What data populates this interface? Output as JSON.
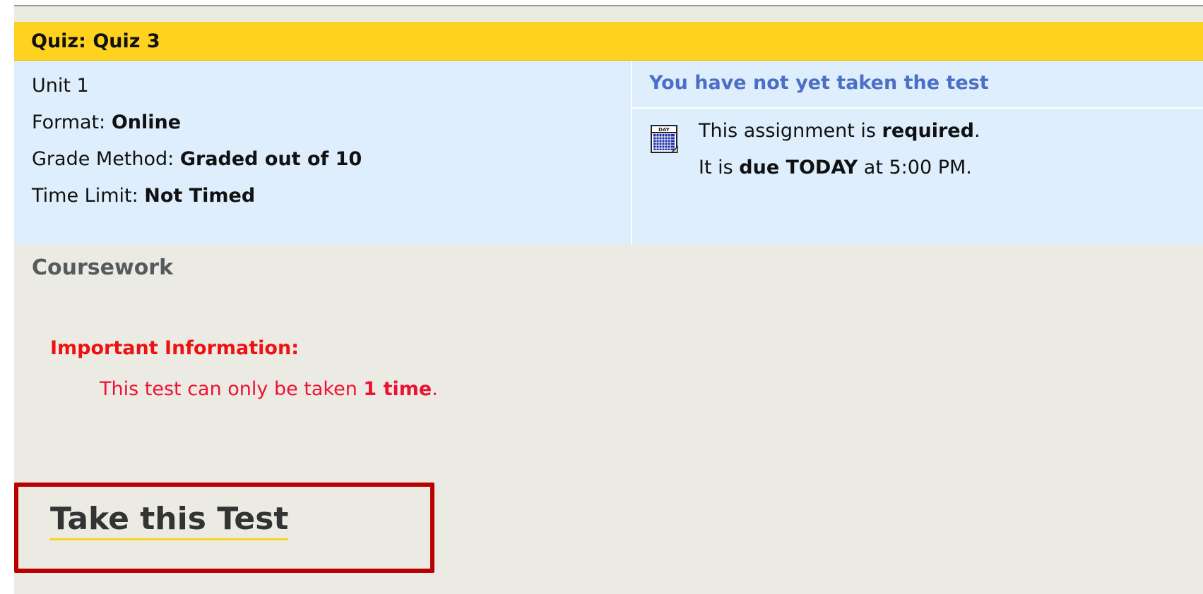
{
  "quiz": {
    "title": "Quiz: Quiz 3",
    "unit": "Unit 1",
    "format_label": "Format: ",
    "format_value": "Online",
    "grade_method_label": "Grade Method: ",
    "grade_method_value": "Graded out of 10",
    "time_limit_label": "Time Limit: ",
    "time_limit_value": "Not Timed"
  },
  "status": {
    "text": "You have not yet taken the test",
    "icon": "calendar-day-icon",
    "required_prefix": "This assignment is ",
    "required_value": "required",
    "required_suffix": ".",
    "due_prefix": "It is ",
    "due_value": "due TODAY",
    "due_suffix": " at 5:00 PM."
  },
  "section": {
    "title": "Coursework"
  },
  "important": {
    "label": "Important Information:",
    "line_prefix": "This test can only be taken ",
    "line_value": "1 time",
    "line_suffix": "."
  },
  "action": {
    "take_test_label": "Take this Test"
  },
  "colors": {
    "header_bg": "#ffd21f",
    "panel_bg": "#dfeefc",
    "page_bg": "#ebebe3",
    "status_blue": "#4b6fc6",
    "important_red": "#ee1111",
    "highlight_border": "#b80000"
  }
}
